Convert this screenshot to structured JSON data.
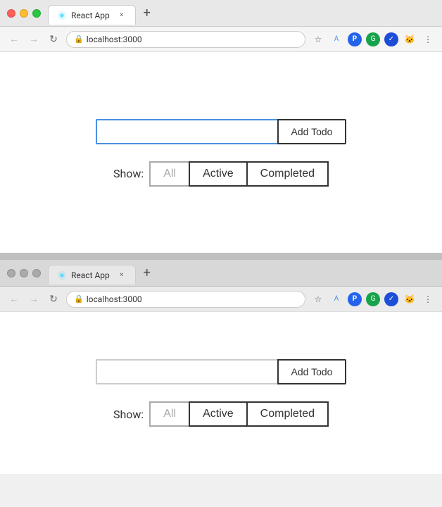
{
  "browser1": {
    "title": "React App",
    "url": "localhost:3000",
    "traffic_lights": [
      "red",
      "yellow",
      "green"
    ],
    "tab_label": "React App",
    "new_tab_label": "+",
    "close_label": "×"
  },
  "browser2": {
    "title": "React App",
    "url": "localhost:3000",
    "tab_label": "React App",
    "new_tab_label": "+",
    "close_label": "×"
  },
  "app": {
    "input_placeholder": "",
    "add_button_label": "Add Todo",
    "show_label": "Show:",
    "filter_all": "All",
    "filter_active": "Active",
    "filter_completed": "Completed"
  }
}
